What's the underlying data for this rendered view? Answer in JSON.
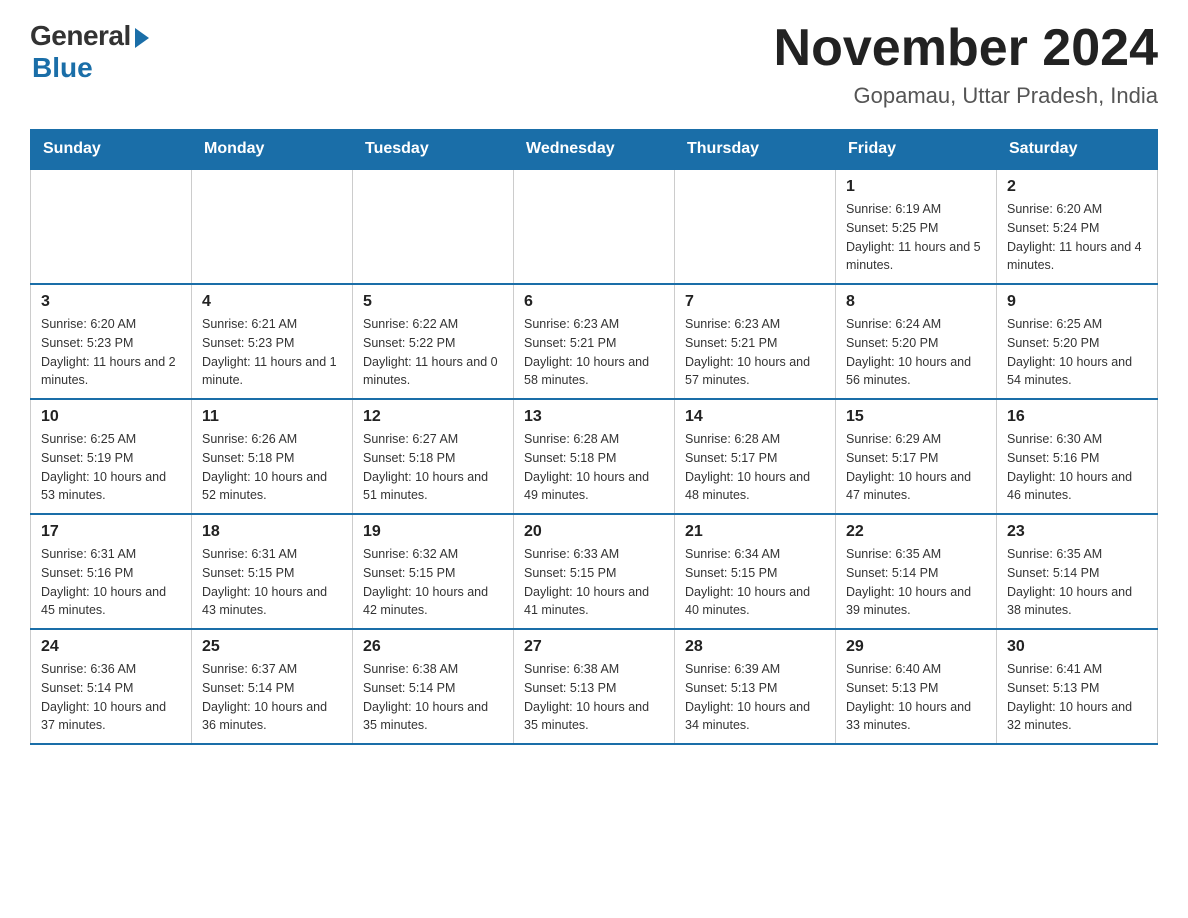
{
  "logo": {
    "general": "General",
    "blue": "Blue"
  },
  "title": "November 2024",
  "subtitle": "Gopamau, Uttar Pradesh, India",
  "days_of_week": [
    "Sunday",
    "Monday",
    "Tuesday",
    "Wednesday",
    "Thursday",
    "Friday",
    "Saturday"
  ],
  "weeks": [
    [
      {
        "day": "",
        "info": ""
      },
      {
        "day": "",
        "info": ""
      },
      {
        "day": "",
        "info": ""
      },
      {
        "day": "",
        "info": ""
      },
      {
        "day": "",
        "info": ""
      },
      {
        "day": "1",
        "info": "Sunrise: 6:19 AM\nSunset: 5:25 PM\nDaylight: 11 hours and 5 minutes."
      },
      {
        "day": "2",
        "info": "Sunrise: 6:20 AM\nSunset: 5:24 PM\nDaylight: 11 hours and 4 minutes."
      }
    ],
    [
      {
        "day": "3",
        "info": "Sunrise: 6:20 AM\nSunset: 5:23 PM\nDaylight: 11 hours and 2 minutes."
      },
      {
        "day": "4",
        "info": "Sunrise: 6:21 AM\nSunset: 5:23 PM\nDaylight: 11 hours and 1 minute."
      },
      {
        "day": "5",
        "info": "Sunrise: 6:22 AM\nSunset: 5:22 PM\nDaylight: 11 hours and 0 minutes."
      },
      {
        "day": "6",
        "info": "Sunrise: 6:23 AM\nSunset: 5:21 PM\nDaylight: 10 hours and 58 minutes."
      },
      {
        "day": "7",
        "info": "Sunrise: 6:23 AM\nSunset: 5:21 PM\nDaylight: 10 hours and 57 minutes."
      },
      {
        "day": "8",
        "info": "Sunrise: 6:24 AM\nSunset: 5:20 PM\nDaylight: 10 hours and 56 minutes."
      },
      {
        "day": "9",
        "info": "Sunrise: 6:25 AM\nSunset: 5:20 PM\nDaylight: 10 hours and 54 minutes."
      }
    ],
    [
      {
        "day": "10",
        "info": "Sunrise: 6:25 AM\nSunset: 5:19 PM\nDaylight: 10 hours and 53 minutes."
      },
      {
        "day": "11",
        "info": "Sunrise: 6:26 AM\nSunset: 5:18 PM\nDaylight: 10 hours and 52 minutes."
      },
      {
        "day": "12",
        "info": "Sunrise: 6:27 AM\nSunset: 5:18 PM\nDaylight: 10 hours and 51 minutes."
      },
      {
        "day": "13",
        "info": "Sunrise: 6:28 AM\nSunset: 5:18 PM\nDaylight: 10 hours and 49 minutes."
      },
      {
        "day": "14",
        "info": "Sunrise: 6:28 AM\nSunset: 5:17 PM\nDaylight: 10 hours and 48 minutes."
      },
      {
        "day": "15",
        "info": "Sunrise: 6:29 AM\nSunset: 5:17 PM\nDaylight: 10 hours and 47 minutes."
      },
      {
        "day": "16",
        "info": "Sunrise: 6:30 AM\nSunset: 5:16 PM\nDaylight: 10 hours and 46 minutes."
      }
    ],
    [
      {
        "day": "17",
        "info": "Sunrise: 6:31 AM\nSunset: 5:16 PM\nDaylight: 10 hours and 45 minutes."
      },
      {
        "day": "18",
        "info": "Sunrise: 6:31 AM\nSunset: 5:15 PM\nDaylight: 10 hours and 43 minutes."
      },
      {
        "day": "19",
        "info": "Sunrise: 6:32 AM\nSunset: 5:15 PM\nDaylight: 10 hours and 42 minutes."
      },
      {
        "day": "20",
        "info": "Sunrise: 6:33 AM\nSunset: 5:15 PM\nDaylight: 10 hours and 41 minutes."
      },
      {
        "day": "21",
        "info": "Sunrise: 6:34 AM\nSunset: 5:15 PM\nDaylight: 10 hours and 40 minutes."
      },
      {
        "day": "22",
        "info": "Sunrise: 6:35 AM\nSunset: 5:14 PM\nDaylight: 10 hours and 39 minutes."
      },
      {
        "day": "23",
        "info": "Sunrise: 6:35 AM\nSunset: 5:14 PM\nDaylight: 10 hours and 38 minutes."
      }
    ],
    [
      {
        "day": "24",
        "info": "Sunrise: 6:36 AM\nSunset: 5:14 PM\nDaylight: 10 hours and 37 minutes."
      },
      {
        "day": "25",
        "info": "Sunrise: 6:37 AM\nSunset: 5:14 PM\nDaylight: 10 hours and 36 minutes."
      },
      {
        "day": "26",
        "info": "Sunrise: 6:38 AM\nSunset: 5:14 PM\nDaylight: 10 hours and 35 minutes."
      },
      {
        "day": "27",
        "info": "Sunrise: 6:38 AM\nSunset: 5:13 PM\nDaylight: 10 hours and 35 minutes."
      },
      {
        "day": "28",
        "info": "Sunrise: 6:39 AM\nSunset: 5:13 PM\nDaylight: 10 hours and 34 minutes."
      },
      {
        "day": "29",
        "info": "Sunrise: 6:40 AM\nSunset: 5:13 PM\nDaylight: 10 hours and 33 minutes."
      },
      {
        "day": "30",
        "info": "Sunrise: 6:41 AM\nSunset: 5:13 PM\nDaylight: 10 hours and 32 minutes."
      }
    ]
  ]
}
